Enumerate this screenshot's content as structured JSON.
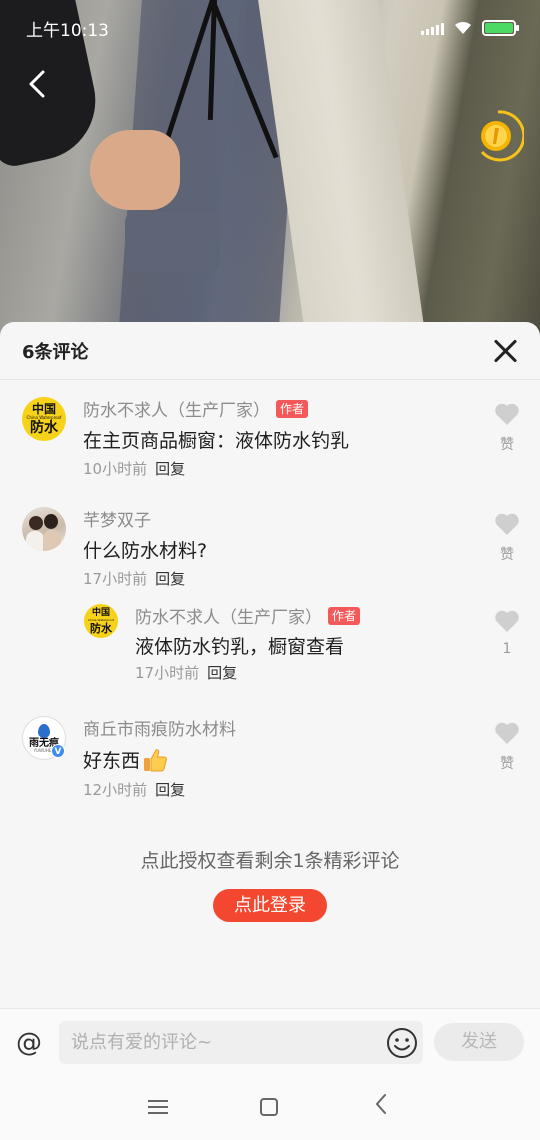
{
  "status_bar": {
    "time": "上午10:13"
  },
  "comment_sheet": {
    "title": "6条评论",
    "comments": [
      {
        "avatar": {
          "line1": "中国",
          "line2": "China Waterproof",
          "line3": "防水"
        },
        "name": "防水不求人（生产厂家）",
        "badge": "作者",
        "text": "在主页商品橱窗：液体防水钓乳",
        "time": "10小时前",
        "reply_label": "回复",
        "like_label": "赞"
      },
      {
        "name": "芊梦双子",
        "text": "什么防水材料?",
        "time": "17小时前",
        "reply_label": "回复",
        "like_label": "赞"
      },
      {
        "avatar": {
          "line1": "中国",
          "line2": "China Waterproof",
          "line3": "防水"
        },
        "name": "防水不求人（生产厂家）",
        "badge": "作者",
        "text": "液体防水钓乳，橱窗查看",
        "time": "17小时前",
        "reply_label": "回复",
        "like_label": "1"
      },
      {
        "avatar": {
          "name": "雨无痕",
          "sub": "YUWUHEN",
          "verified": "V"
        },
        "name": "商丘市雨痕防水材料",
        "text": "好东西",
        "time": "12小时前",
        "reply_label": "回复",
        "like_label": "赞"
      }
    ],
    "more_text": "点此授权查看剩余1条精彩评论",
    "login_button": "点此登录"
  },
  "input_bar": {
    "at_symbol": "@",
    "placeholder": "说点有爱的评论~",
    "send_label": "发送"
  },
  "colors": {
    "accent": "#f3482f",
    "author_badge": "#f4595a",
    "verified": "#3d8cf0"
  },
  "icons": [
    "back-icon",
    "coin-icon",
    "close-icon",
    "heart-icon",
    "thumbs-up-icon",
    "emoji-icon",
    "menu-icon",
    "home-icon",
    "nav-back-icon"
  ]
}
